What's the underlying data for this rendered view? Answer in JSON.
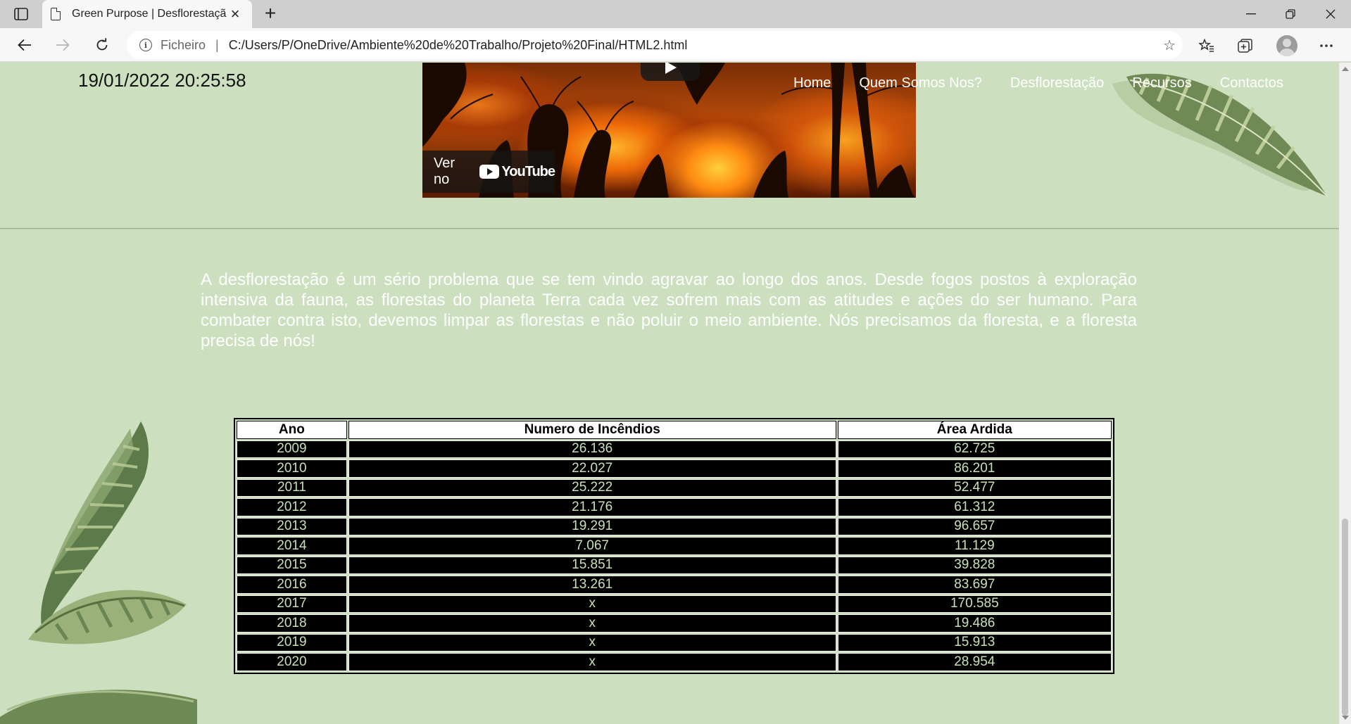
{
  "browser": {
    "tab_title": "Green Purpose | Desflorestação",
    "address_scheme": "Ficheiro",
    "address_separator": "|",
    "address_url": "C:/Users/P/OneDrive/Ambiente%20de%20Trabalho/Projeto%20Final/HTML2.html"
  },
  "page": {
    "datetime": "19/01/2022 20:25:58",
    "nav": [
      "Home",
      "Quem Somos Nos?",
      "Desflorestação",
      "Recursos",
      "Contactos"
    ],
    "video": {
      "watch_on": "Ver no",
      "platform": "YouTube"
    },
    "intro": "A desflorestação é um sério problema que se tem vindo agravar ao longo dos anos. Desde fogos postos à exploração intensiva da fauna, as florestas do planeta Terra cada vez sofrem mais com as atitudes e ações do ser humano. Para combater contra isto, devemos limpar as florestas e não poluir o meio ambiente. Nós precisamos da floresta, e a floresta precisa de nós!",
    "table": {
      "headers": [
        "Ano",
        "Numero de Incêndios",
        "Área Ardida"
      ],
      "rows": [
        [
          "2009",
          "26.136",
          "62.725"
        ],
        [
          "2010",
          "22.027",
          "86.201"
        ],
        [
          "2011",
          "25.222",
          "52.477"
        ],
        [
          "2012",
          "21.176",
          "61.312"
        ],
        [
          "2013",
          "19.291",
          "96.657"
        ],
        [
          "2014",
          "7.067",
          "11.129"
        ],
        [
          "2015",
          "15.851",
          "39.828"
        ],
        [
          "2016",
          "13.261",
          "83.697"
        ],
        [
          "2017",
          "x",
          "170.585"
        ],
        [
          "2018",
          "x",
          "19.486"
        ],
        [
          "2019",
          "x",
          "15.913"
        ],
        [
          "2020",
          "x",
          "28.954"
        ]
      ]
    }
  },
  "colors": {
    "page_background": "#ccdfbf",
    "nav_text": "#ffffff",
    "table_cell_text": "#c8e0b7"
  }
}
